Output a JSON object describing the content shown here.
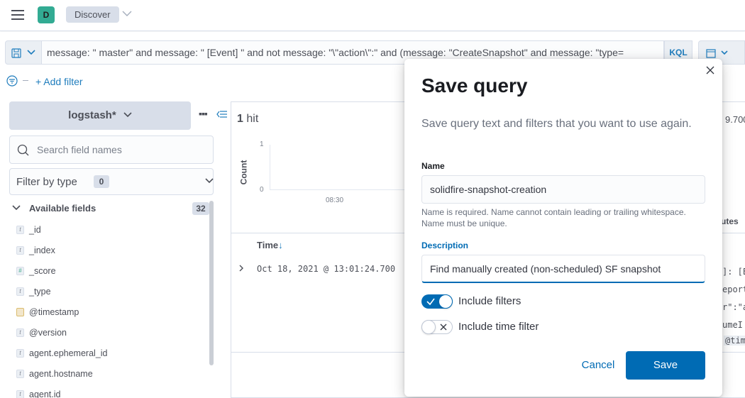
{
  "header": {
    "space_initial": "D",
    "breadcrumb": "Discover"
  },
  "query": {
    "text": "message: \" master\" and message: \" [Event] \" and not message: \"\\\"action\\\":\" and (message: \"CreateSnapshot\" and message: \"type=",
    "language": "KQL",
    "add_filter": "+ Add filter"
  },
  "sidebar": {
    "index_pattern": "logstash*",
    "search_placeholder": "Search field names",
    "filter_by_type": "Filter by type",
    "filter_count": "0",
    "available_fields_label": "Available fields",
    "available_fields_count": "32",
    "fields": [
      {
        "name": "_id",
        "type": "t"
      },
      {
        "name": "_index",
        "type": "t"
      },
      {
        "name": "_score",
        "type": "#"
      },
      {
        "name": "_type",
        "type": "t"
      },
      {
        "name": "@timestamp",
        "type": "date"
      },
      {
        "name": "@version",
        "type": "t"
      },
      {
        "name": "agent.ephemeral_id",
        "type": "t"
      },
      {
        "name": "agent.hostname",
        "type": "t"
      },
      {
        "name": "agent.id",
        "type": "t"
      }
    ]
  },
  "main": {
    "hits_count": "1",
    "hits_label": "hit",
    "count_axis_label": "Count",
    "y_ticks": [
      "1",
      "0"
    ],
    "x_tick": "08:30",
    "time_column": "Time",
    "sort_arrow": "↓",
    "row_time": "Oct 18, 2021 @ 13:01:24.700",
    "peek_fragments": [
      "9.700",
      "utes",
      "]: [E",
      "eport",
      "r\":\"a",
      "umeI",
      "@tim"
    ]
  },
  "modal": {
    "title": "Save query",
    "description": "Save query text and filters that you want to use again.",
    "name_label": "Name",
    "name_value": "solidfire-snapshot-creation",
    "name_help": "Name is required. Name cannot contain leading or trailing whitespace. Name must be unique.",
    "description_label": "Description",
    "description_value": "Find manually created (non-scheduled) SF snapshot",
    "include_filters_label": "Include filters",
    "include_filters_on": true,
    "include_time_label": "Include time filter",
    "include_time_on": false,
    "cancel_label": "Cancel",
    "save_label": "Save"
  },
  "colors": {
    "primary": "#006bb4",
    "space_avatar": "#16a085"
  }
}
